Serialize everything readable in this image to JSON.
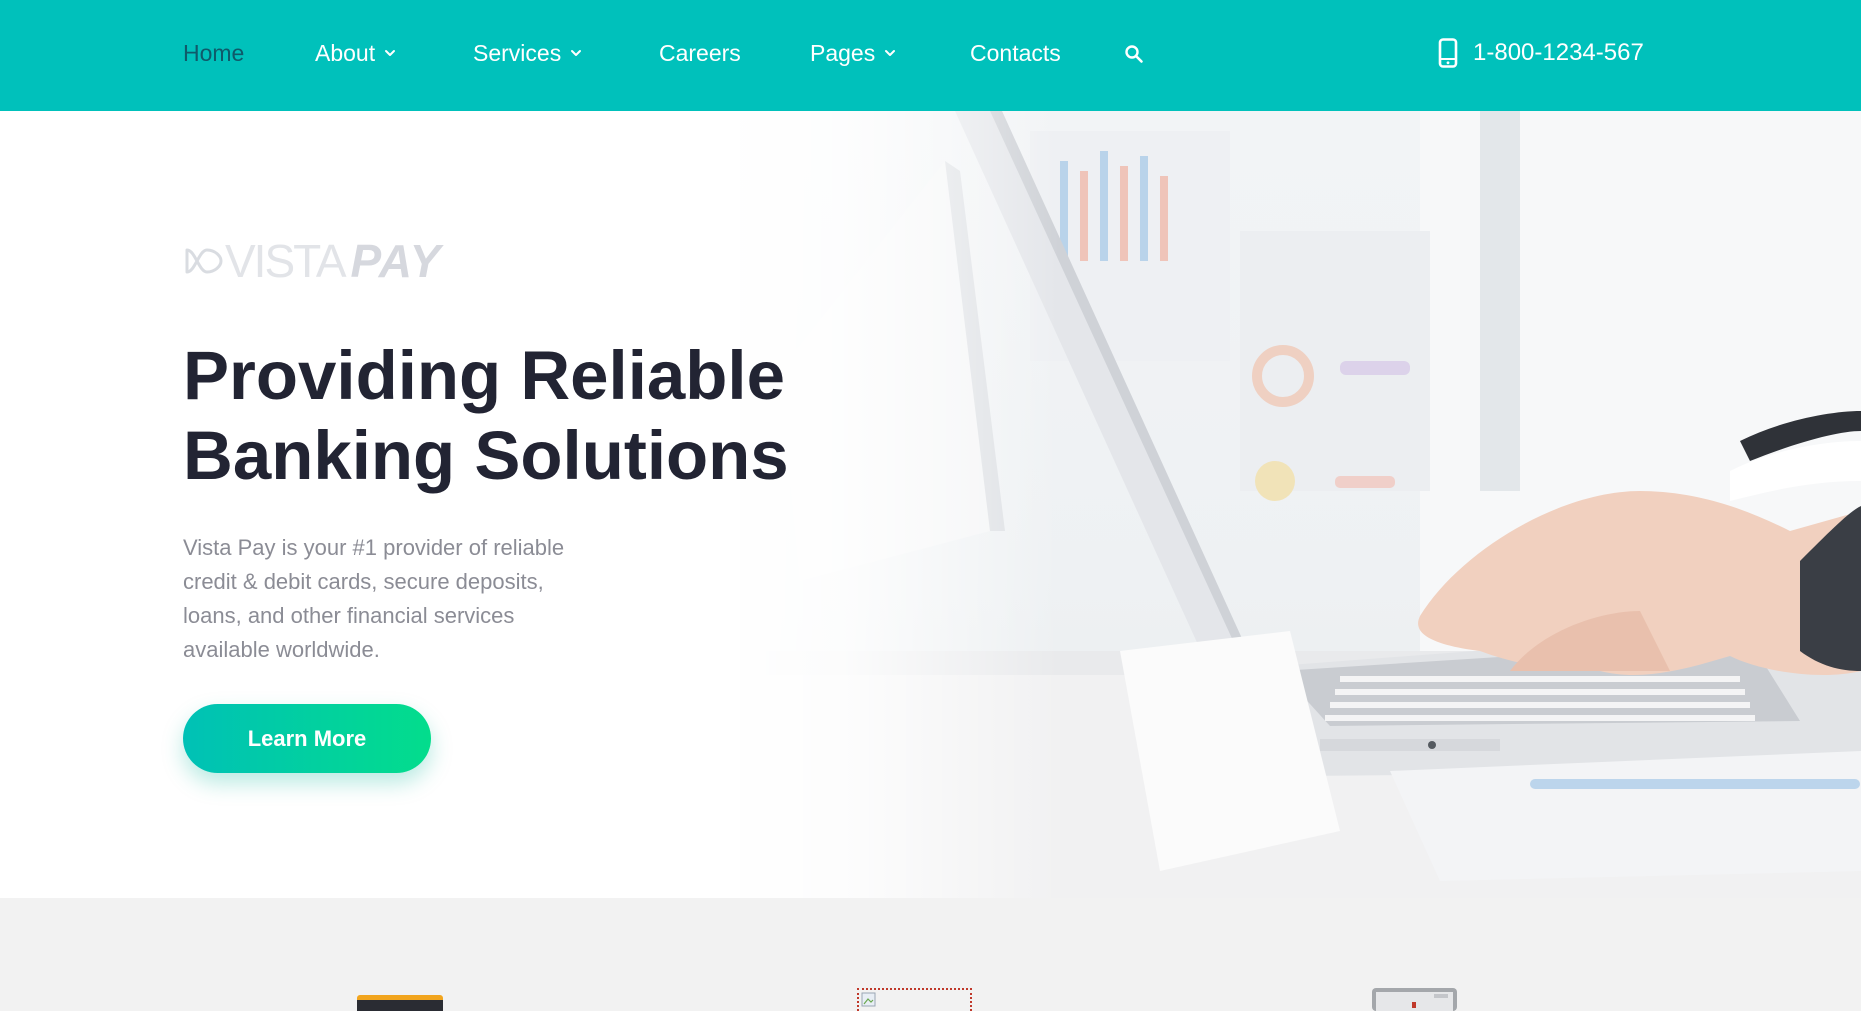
{
  "nav": {
    "items": [
      {
        "label": "Home",
        "has_dropdown": false,
        "active": true
      },
      {
        "label": "About",
        "has_dropdown": true,
        "active": false
      },
      {
        "label": "Services",
        "has_dropdown": true,
        "active": false
      },
      {
        "label": "Careers",
        "has_dropdown": false,
        "active": false
      },
      {
        "label": "Pages",
        "has_dropdown": true,
        "active": false
      },
      {
        "label": "Contacts",
        "has_dropdown": false,
        "active": false
      }
    ],
    "search_icon": "search-icon",
    "phone_icon": "mobile-phone-icon",
    "phone": "1-800-1234-567"
  },
  "hero": {
    "brand": {
      "word1": "VISTA",
      "word2": "PAY"
    },
    "title_line1": "Providing Reliable",
    "title_line2": "Banking Solutions",
    "description": "Vista Pay is your #1 provider of reliable credit & debit cards, secure deposits, loans, and other financial services available worldwide.",
    "cta_label": "Learn More",
    "image": "laptop-typing-hands-photo"
  },
  "features": {
    "icons": [
      "credit-card-icon",
      "broken-image-icon",
      "safe-box-icon"
    ]
  },
  "colors": {
    "header_bg": "#00c1bb",
    "active_nav": "#0f5a6a",
    "title": "#222433",
    "body_text": "#8b8c95",
    "cta_start": "#00c1b6",
    "cta_end": "#03dd8c",
    "section_bg": "#f2f2f2"
  }
}
